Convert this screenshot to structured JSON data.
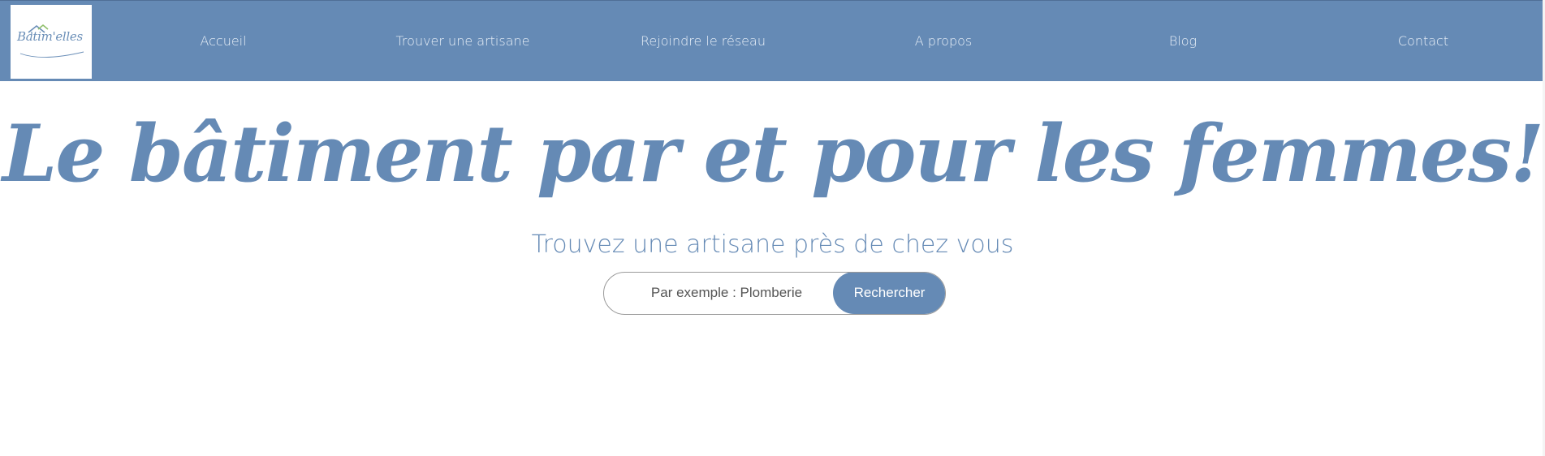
{
  "brand": {
    "logo_text": "Batim'elles",
    "accent_color": "#658ab5",
    "leaf_color": "#8fbf6a"
  },
  "nav": {
    "items": [
      {
        "label": "Accueil"
      },
      {
        "label": "Trouver une artisane"
      },
      {
        "label": "Rejoindre le réseau"
      },
      {
        "label": "A propos"
      },
      {
        "label": "Blog"
      },
      {
        "label": "Contact"
      }
    ]
  },
  "hero": {
    "title": "Le bâtiment par et pour les femmes!",
    "subtitle": "Trouvez une artisane près de chez vous"
  },
  "search": {
    "placeholder": "Par exemple : Plomberie",
    "value": "",
    "button_label": "Rechercher"
  }
}
